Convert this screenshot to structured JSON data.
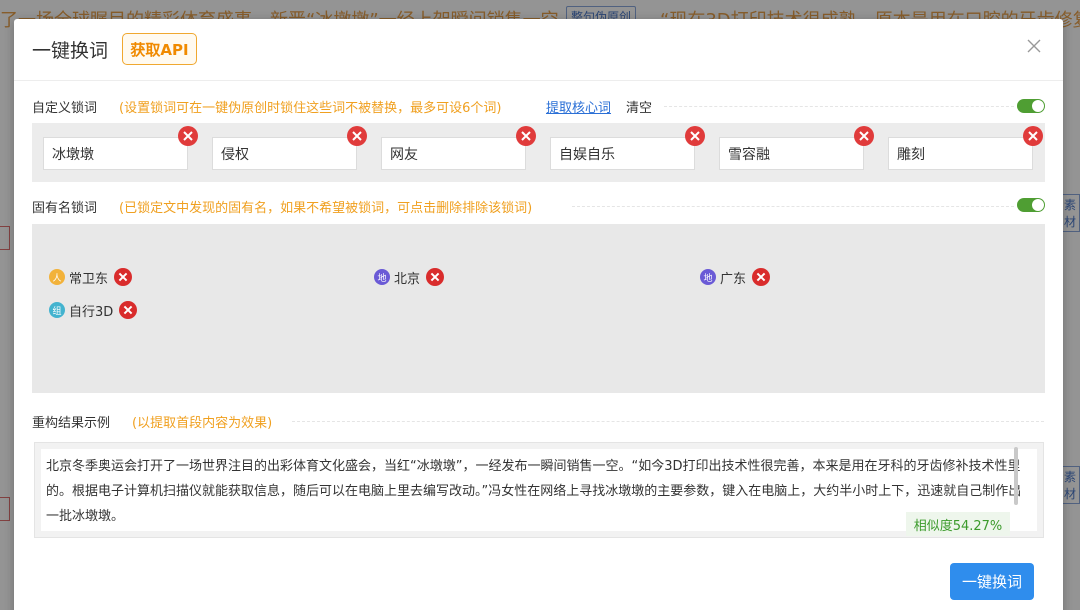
{
  "background": {
    "headline": "了一场全球瞩目的精彩体育盛事，新晋“冰墩墩”一经上架瞬间销售一空",
    "badge": "整句伪原创",
    "headline_right": "“现在3D打印技术很成熟，原本是用在口腔的牙齿修复",
    "side_tags": [
      "素材",
      "素材"
    ]
  },
  "dialog": {
    "title": "一键换词",
    "api_button": "获取API"
  },
  "custom_lock": {
    "label": "自定义锁词",
    "hint": "(设置锁词可在一键伪原创时锁住这些词不被替换，最多可设6个词)",
    "extract_link": "提取核心词",
    "clear_action": "清空",
    "toggle_on": true,
    "words": [
      "冰墩墩",
      "侵权",
      "网友",
      "自娱自乐",
      "雪容融",
      "雕刻"
    ]
  },
  "proper_lock": {
    "label": "固有名锁词",
    "hint": "(已锁定文中发现的固有名，如果不希望被锁词，可点击删除排除该锁词)",
    "toggle_on": true,
    "items": [
      {
        "category": "人",
        "text": "常卫东",
        "color": "#f2b23a"
      },
      {
        "category": "地",
        "text": "北京",
        "color": "#6a5ad6"
      },
      {
        "category": "地",
        "text": "广东",
        "color": "#6a5ad6"
      },
      {
        "category": "组",
        "text": "自行3D",
        "color": "#43b3cf"
      }
    ]
  },
  "result": {
    "label": "重构结果示例",
    "hint": "(以提取首段内容为效果)",
    "text": "北京冬季奥运会打开了一场世界注目的出彩体育文化盛会，当红“冰墩墩”，一经发布一瞬间销售一空。“如今3D打印出技术性很完善，本来是用在牙科的牙齿修补技术性里的。根据电子计算机扫描仪就能获取信息，随后可以在电脑上里去编写改动。”冯女性在网络上寻找冰墩墩的主要参数，键入在电脑上，大约半小时上下，迅速就自己制作出一批冰墩墩。",
    "similarity": "相似度54.27%"
  },
  "primary_button": "一键换词"
}
